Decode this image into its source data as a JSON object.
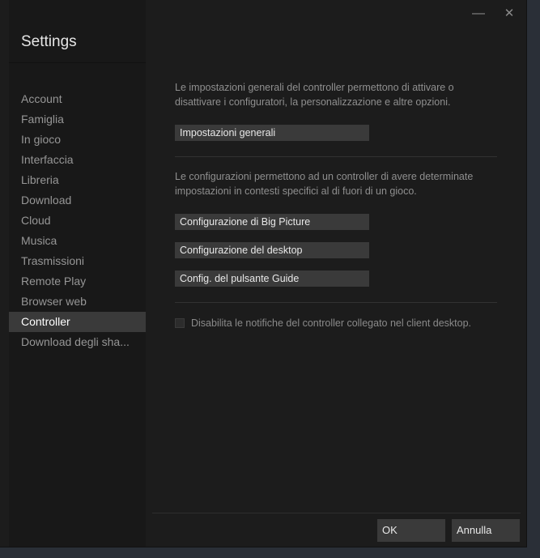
{
  "window": {
    "minimize_glyph": "—",
    "close_glyph": "✕"
  },
  "sidebar": {
    "title": "Settings",
    "items": [
      {
        "label": "Account"
      },
      {
        "label": "Famiglia"
      },
      {
        "label": "In gioco"
      },
      {
        "label": "Interfaccia"
      },
      {
        "label": "Libreria"
      },
      {
        "label": "Download"
      },
      {
        "label": "Cloud"
      },
      {
        "label": "Musica"
      },
      {
        "label": "Trasmissioni"
      },
      {
        "label": "Remote Play"
      },
      {
        "label": "Browser web"
      },
      {
        "label": "Controller",
        "active": true
      },
      {
        "label": "Download degli sha..."
      }
    ]
  },
  "controller": {
    "general_description": "Le impostazioni generali del controller permettono di attivare o disattivare i configuratori, la personalizzazione e altre opzioni.",
    "general_button": "Impostazioni generali",
    "config_description": "Le configurazioni permettono ad un controller di avere determinate impostazioni in contesti specifici al di fuori di un gioco.",
    "big_picture_button": "Configurazione di Big Picture",
    "desktop_button": "Configurazione del desktop",
    "guide_button": "Config. del pulsante Guide",
    "disable_notifications_label": "Disabilita le notifiche del controller collegato nel client desktop."
  },
  "footer": {
    "ok_label": "OK",
    "cancel_label": "Annulla"
  },
  "colors": {
    "window_bg": "#1c1c1c",
    "sidebar_bg": "#181818",
    "active_item_bg": "#3a3a3a",
    "button_bg": "#3a3a3a"
  }
}
